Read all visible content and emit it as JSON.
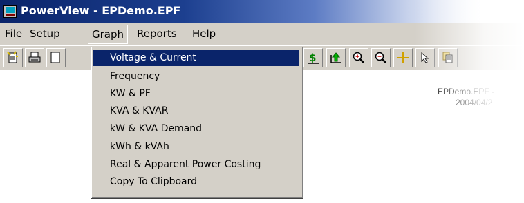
{
  "window": {
    "title": "PowerView - EPDemo.EPF"
  },
  "menubar": {
    "items": [
      {
        "label": "File"
      },
      {
        "label": "Setup"
      },
      {
        "label": "Graph"
      },
      {
        "label": "Reports"
      },
      {
        "label": "Help"
      }
    ]
  },
  "graph_menu": {
    "items": [
      {
        "label": "Voltage & Current"
      },
      {
        "label": "Frequency"
      },
      {
        "label": "KW & PF"
      },
      {
        "label": "KVA & KVAR"
      },
      {
        "label": "kW & KVA Demand"
      },
      {
        "label": "kWh & kVAh"
      },
      {
        "label": "Real & Apparent Power Costing"
      },
      {
        "label": "Copy To Clipboard"
      }
    ],
    "selected": "Voltage & Current"
  },
  "toolbar": {
    "icons": [
      "new-file-icon",
      "print-icon",
      "document-icon",
      "cost-icon",
      "export-up-icon",
      "zoom-in-icon",
      "zoom-out-icon",
      "crosshair-icon",
      "pointer-icon",
      "copy-icon"
    ]
  },
  "document": {
    "line1": "EPDemo.EPF -",
    "line2": "2004/04/2"
  },
  "colors": {
    "highlight": "#0a246a",
    "chrome": "#d4d0c8"
  }
}
